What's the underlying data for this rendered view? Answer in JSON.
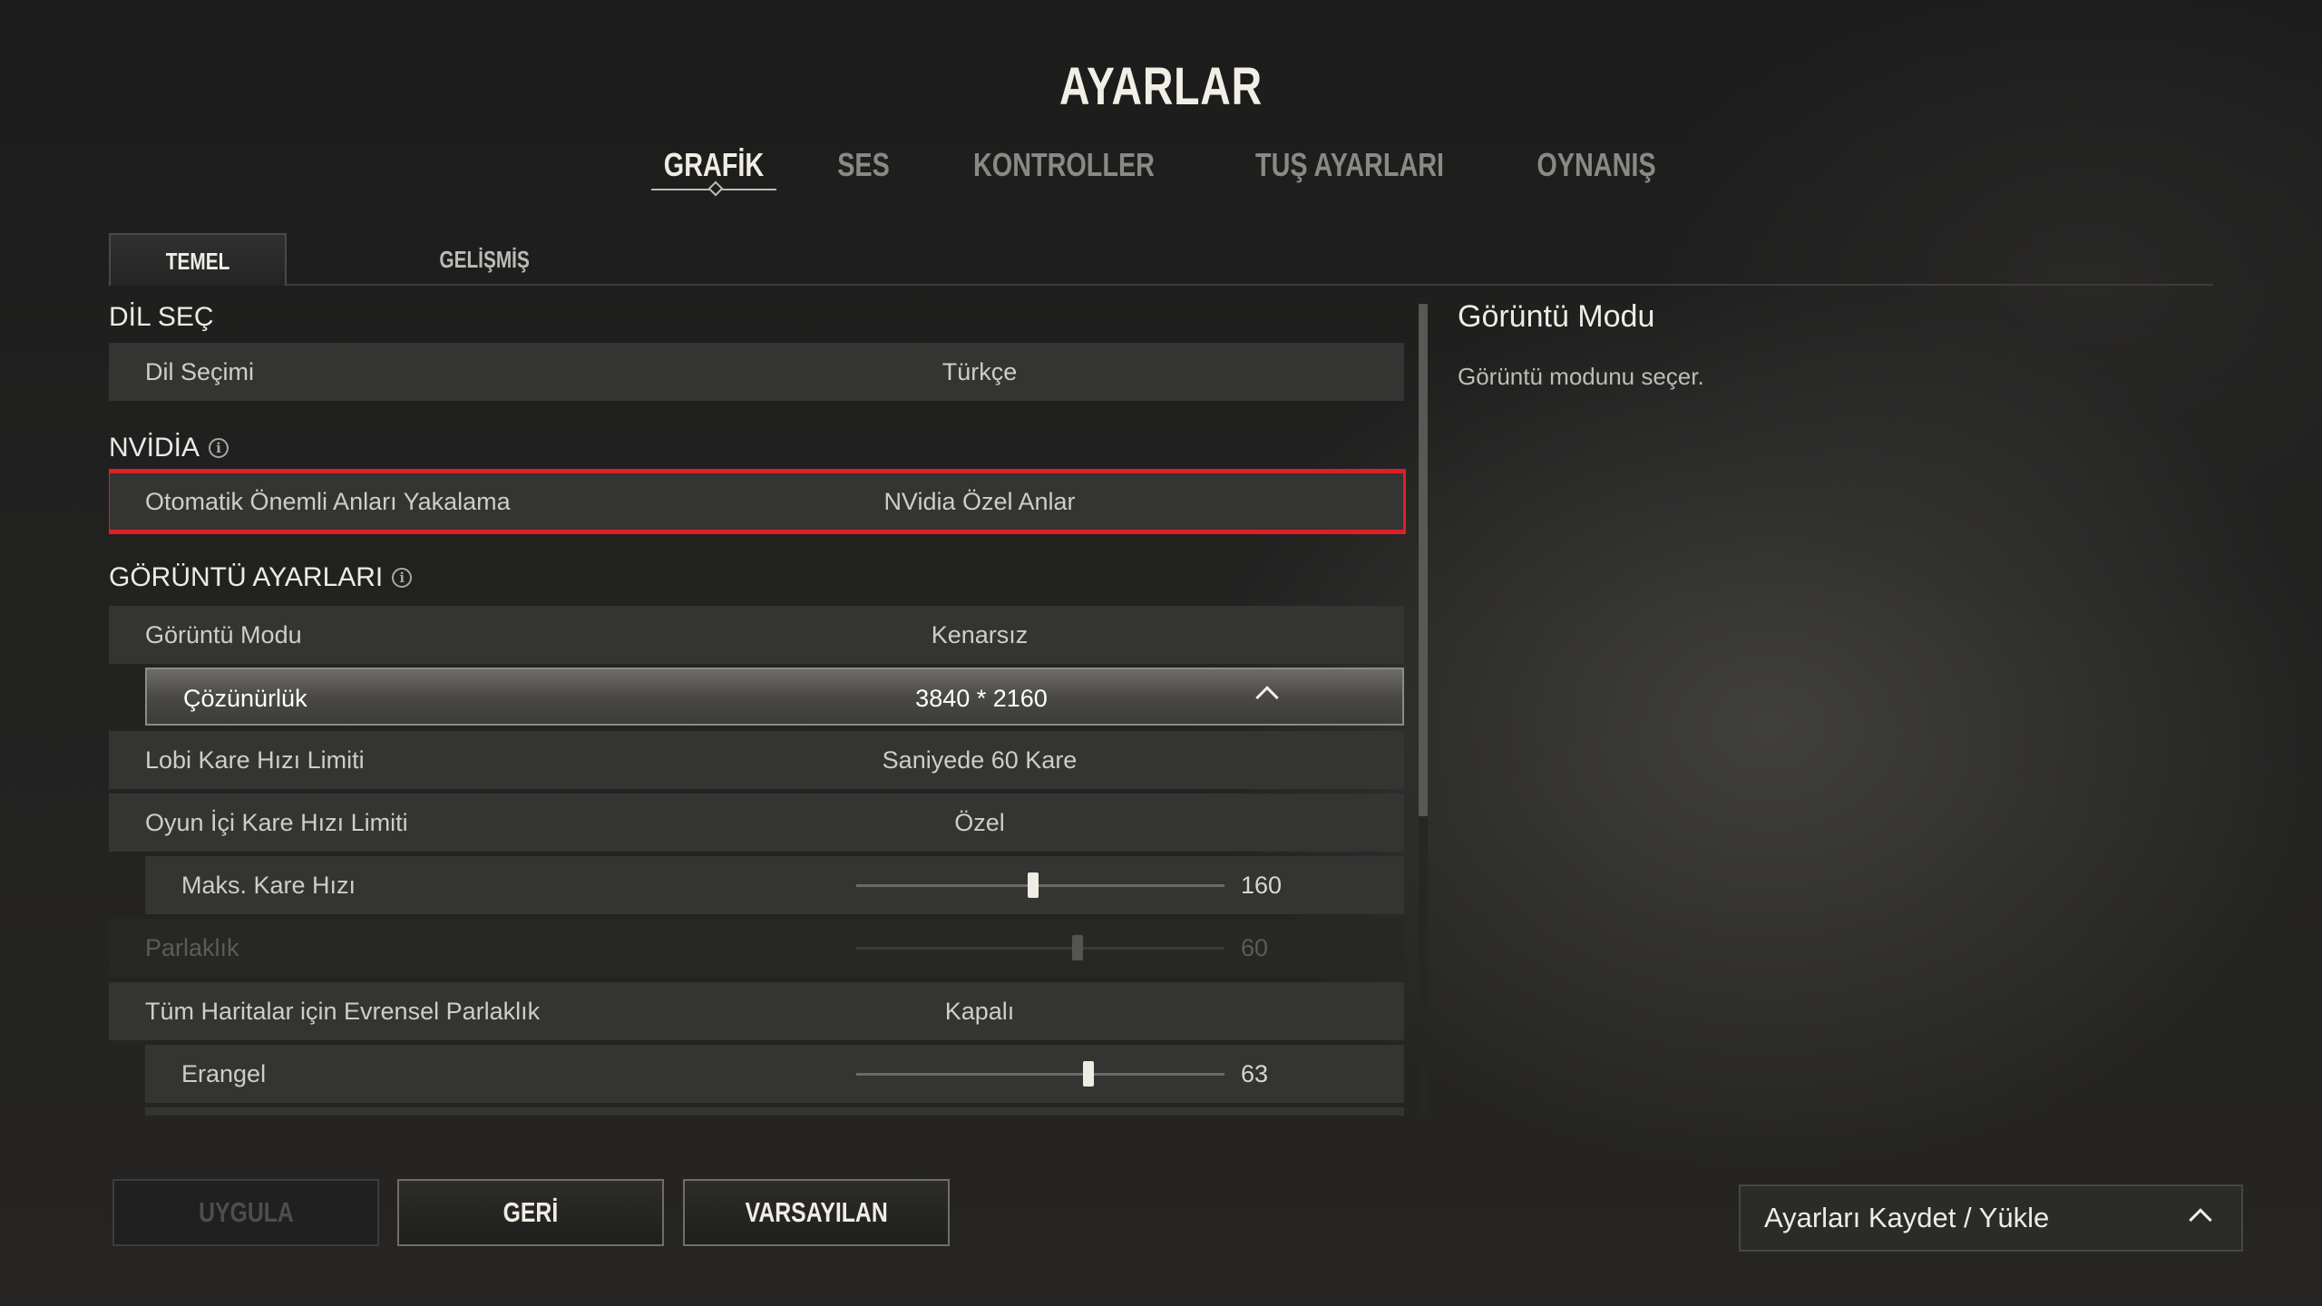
{
  "title": "AYARLAR",
  "top_tabs": [
    {
      "label": "GRAFİK",
      "active": true
    },
    {
      "label": "SES",
      "active": false
    },
    {
      "label": "KONTROLLER",
      "active": false
    },
    {
      "label": "TUŞ AYARLARI",
      "active": false
    },
    {
      "label": "OYNANIŞ",
      "active": false
    }
  ],
  "sub_tabs": [
    {
      "label": "TEMEL",
      "active": true
    },
    {
      "label": "GELİŞMİŞ",
      "active": false
    }
  ],
  "sections": {
    "language": {
      "header": "DİL SEÇ",
      "language_select": {
        "label": "Dil Seçimi",
        "value": "Türkçe"
      }
    },
    "nvidia": {
      "header": "NVİDİA",
      "auto_highlights": {
        "label": "Otomatik Önemli Anları Yakalama",
        "value": "NVidia Özel Anlar"
      }
    },
    "display": {
      "header": "GÖRÜNTÜ AYARLARI",
      "display_mode": {
        "label": "Görüntü Modu",
        "value": "Kenarsız"
      },
      "resolution": {
        "label": "Çözünürlük",
        "value": "3840 * 2160"
      },
      "lobby_fps": {
        "label": "Lobi Kare Hızı Limiti",
        "value": "Saniyede 60 Kare"
      },
      "ingame_fps": {
        "label": "Oyun İçi Kare Hızı Limiti",
        "value": "Özel"
      },
      "max_fps": {
        "label": "Maks. Kare Hızı",
        "value": "160",
        "slider_fraction": 0.48
      },
      "brightness": {
        "label": "Parlaklık",
        "value": "60",
        "slider_fraction": 0.6,
        "disabled": true
      },
      "universal_brightness": {
        "label": "Tüm Haritalar için Evrensel Parlaklık",
        "value": "Kapalı"
      },
      "erangel": {
        "label": "Erangel",
        "value": "63",
        "slider_fraction": 0.63
      }
    }
  },
  "description": {
    "title": "Görüntü Modu",
    "text": "Görüntü modunu seçer."
  },
  "buttons": {
    "apply": "UYGULA",
    "back": "GERİ",
    "default": "VARSAYILAN"
  },
  "save_load": {
    "label": "Ayarları Kaydet / Yükle"
  },
  "colors": {
    "highlight_border": "#dd1f26",
    "background": "#1c1c1c",
    "row_bg": "#343433"
  }
}
